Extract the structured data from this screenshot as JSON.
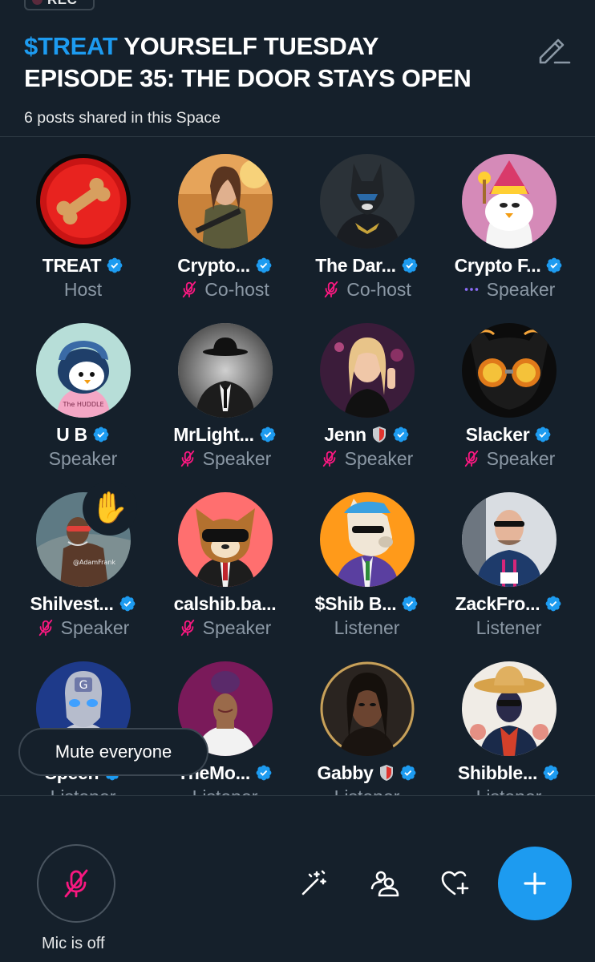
{
  "rec_label": "REC",
  "title": {
    "ticker": "$TREAT",
    "line1_rest": " YOURSELF TUESDAY",
    "line2": "EPISODE 35: THE DOOR STAYS OPEN"
  },
  "subtitle": "6 posts shared in this Space",
  "participants": [
    {
      "name": "TREAT",
      "role": "Host",
      "verified": true,
      "mic": "none"
    },
    {
      "name": "Crypto...",
      "role": "Co-host",
      "verified": true,
      "mic": "muted"
    },
    {
      "name": "The Dar...",
      "role": "Co-host",
      "verified": true,
      "mic": "muted"
    },
    {
      "name": "Crypto F...",
      "role": "Speaker",
      "verified": true,
      "mic": "speaking"
    },
    {
      "name": "U B",
      "role": "Speaker",
      "verified": true,
      "mic": "none"
    },
    {
      "name": "MrLight...",
      "role": "Speaker",
      "verified": true,
      "mic": "muted"
    },
    {
      "name": "Jenn",
      "role": "Speaker",
      "verified": true,
      "mic": "muted",
      "shield": true
    },
    {
      "name": "Slacker",
      "role": "Speaker",
      "verified": true,
      "mic": "muted"
    },
    {
      "name": "Shilvest...",
      "role": "Speaker",
      "verified": true,
      "mic": "muted",
      "hand": "✋"
    },
    {
      "name": "calshib.ba...",
      "role": "Speaker",
      "verified": false,
      "mic": "muted"
    },
    {
      "name": "$Shib B...",
      "role": "Listener",
      "verified": true,
      "mic": "none"
    },
    {
      "name": "ZackFro...",
      "role": "Listener",
      "verified": true,
      "mic": "none"
    },
    {
      "name": "Speen",
      "role": "Listener",
      "verified": true,
      "mic": "none"
    },
    {
      "name": "TheMo...",
      "role": "Listener",
      "verified": true,
      "mic": "none"
    },
    {
      "name": "Gabby",
      "role": "Listener",
      "verified": true,
      "mic": "none",
      "shield": true
    },
    {
      "name": "Shibble...",
      "role": "Listener",
      "verified": true,
      "mic": "none"
    }
  ],
  "toast": "Mute everyone",
  "mic_label": "Mic is off",
  "colors": {
    "background": "#15202b",
    "accent": "#1d9bf0",
    "muted": "#f91880",
    "secondary_text": "#8b98a5"
  },
  "icons": {
    "edit": "pencil-icon",
    "effects": "magic-wand-icon",
    "people": "people-icon",
    "react": "heart-plus-icon",
    "add": "plus-icon",
    "mic": "mic-off-icon"
  }
}
